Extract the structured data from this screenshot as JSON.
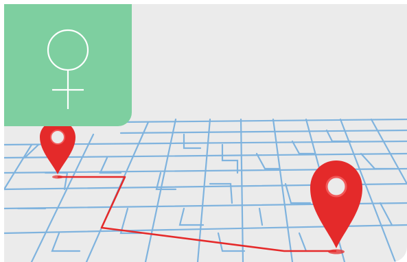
{
  "image": {
    "subject": "map-with-location-pins",
    "background_color": "#ebebeb",
    "road_color": "#7fb3de",
    "route_color": "#e52a2a",
    "pin_color": "#e42a2a",
    "pin_highlight_color": "#f25a5a"
  },
  "badge": {
    "icon": "female-symbol-icon",
    "background_color": "#7ecfa0",
    "icon_color": "#ffffff"
  }
}
